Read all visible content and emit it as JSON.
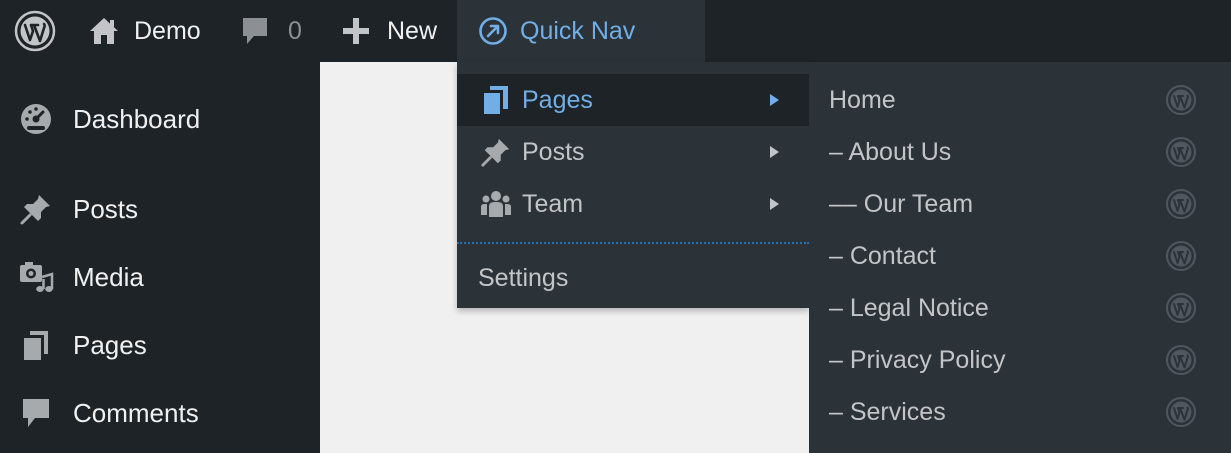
{
  "adminbar": {
    "wp_logo_icon": "wordpress-logo-icon",
    "site_name": "Demo",
    "site_icon": "home-icon",
    "comments_icon": "comment-bubble-icon",
    "comments_count": "0",
    "new_icon": "plus-icon",
    "new_label": "New",
    "quick_nav_icon": "external-arrow-circle-icon",
    "quick_nav_label": "Quick Nav"
  },
  "sidebar": {
    "items": [
      {
        "label": "Dashboard",
        "icon": "dashboard-gauge-icon"
      },
      {
        "label": "Posts",
        "icon": "pushpin-icon"
      },
      {
        "label": "Media",
        "icon": "media-camera-icon"
      },
      {
        "label": "Pages",
        "icon": "pages-icon"
      },
      {
        "label": "Comments",
        "icon": "comment-bubble-icon"
      }
    ]
  },
  "quick_nav": {
    "items": [
      {
        "label": "Pages",
        "icon": "pages-icon",
        "active": true
      },
      {
        "label": "Posts",
        "icon": "pushpin-icon",
        "active": false
      },
      {
        "label": "Team",
        "icon": "groups-icon",
        "active": false
      }
    ],
    "settings_label": "Settings"
  },
  "pages_submenu": {
    "items": [
      {
        "label": "Home",
        "icon": "wordpress-logo-icon"
      },
      {
        "label": "– About Us",
        "icon": "wordpress-logo-icon"
      },
      {
        "label": "–– Our Team",
        "icon": "wordpress-logo-icon"
      },
      {
        "label": "– Contact",
        "icon": "wordpress-logo-icon"
      },
      {
        "label": "– Legal Notice",
        "icon": "wordpress-logo-icon"
      },
      {
        "label": "– Privacy Policy",
        "icon": "wordpress-logo-icon"
      },
      {
        "label": "– Services",
        "icon": "wordpress-logo-icon"
      }
    ]
  },
  "colors": {
    "admin_bar_bg": "#1d2327",
    "submenu_bg": "#2c3338",
    "accent_blue": "#72aee6",
    "text_light": "#f0f0f1",
    "text_muted": "#c3c4c7",
    "content_bg": "#f0f0f1"
  }
}
